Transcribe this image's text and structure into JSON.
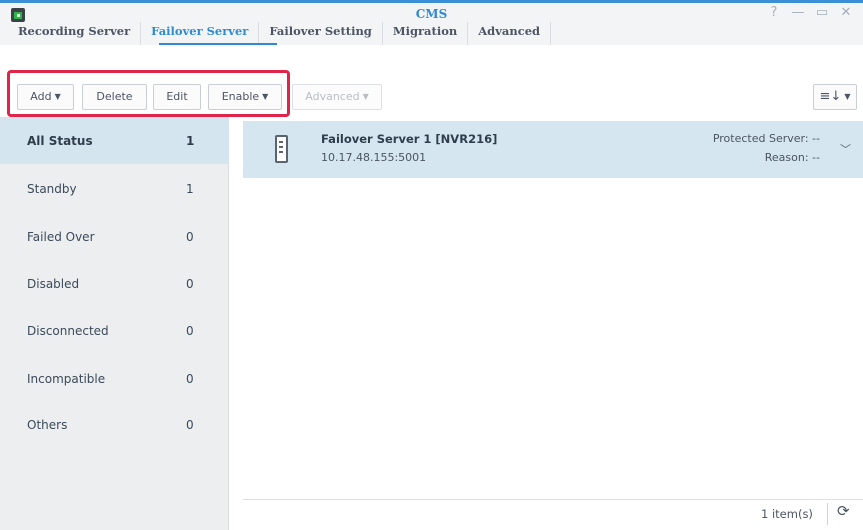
{
  "window": {
    "title": "CMS",
    "controls": [
      "?",
      "—",
      "▭",
      "✕"
    ]
  },
  "tabs": [
    {
      "label": "Recording Server",
      "active": false
    },
    {
      "label": "Failover Server",
      "active": true
    },
    {
      "label": "Failover Setting",
      "active": false
    },
    {
      "label": "Migration",
      "active": false
    },
    {
      "label": "Advanced",
      "active": false
    }
  ],
  "toolbar": {
    "add_label": "Add",
    "delete_label": "Delete",
    "edit_label": "Edit",
    "enable_label": "Enable",
    "advanced_label": "Advanced",
    "sort_icon": "≡↓"
  },
  "sidebar": {
    "items": [
      {
        "label": "All Status",
        "count": "1",
        "active": true
      },
      {
        "label": "Standby",
        "count": "1",
        "active": false
      },
      {
        "label": "Failed Over",
        "count": "0",
        "active": false
      },
      {
        "label": "Disabled",
        "count": "0",
        "active": false
      },
      {
        "label": "Disconnected",
        "count": "0",
        "active": false
      },
      {
        "label": "Incompatible",
        "count": "0",
        "active": false
      },
      {
        "label": "Others",
        "count": "0",
        "active": false
      }
    ]
  },
  "servers": [
    {
      "name": "Failover Server 1 [NVR216]",
      "address": "10.17.48.155:5001",
      "protected": "Protected Server: --",
      "reason": "Reason: --"
    }
  ],
  "footer": {
    "count": "1 item(s)"
  },
  "colors": {
    "accent": "#2f8bd0",
    "highlight": "#e0254a",
    "selected_row": "#d5e6f0"
  }
}
